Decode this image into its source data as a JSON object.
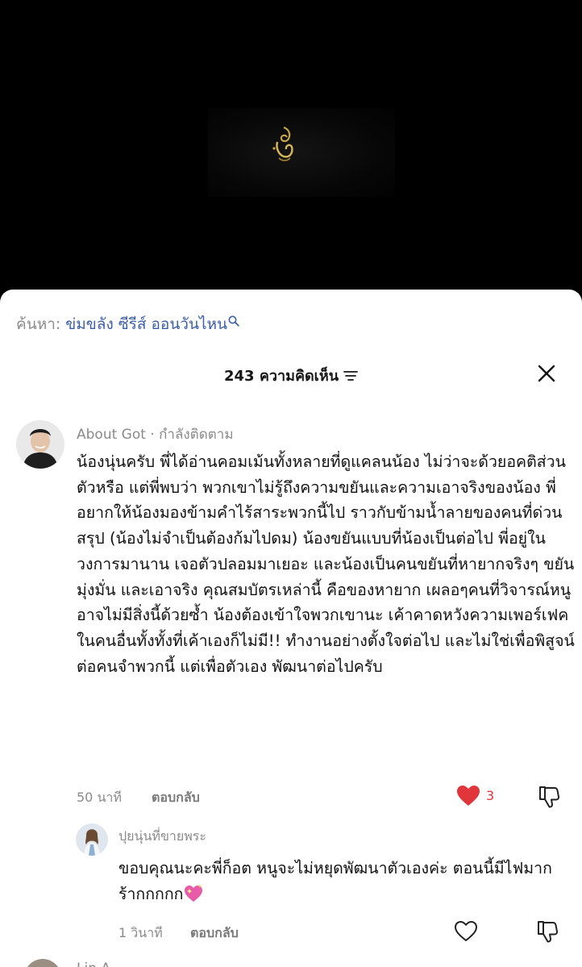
{
  "search": {
    "prefix": "ค้นหา:",
    "query": "ข่มขลัง ซีรีส์ ออนวันไหน"
  },
  "header": {
    "comment_count_label": "243 ความคิดเห็น"
  },
  "comments": [
    {
      "author": "About Got · กำลังติดตาม",
      "text": "น้องนุ่นครับ พี่ได้อ่านคอมเม้นทั้งหลายที่ดูแคลนน้อง ไม่ว่าจะด้วยอคติส่วนตัวหรือ แต่พี่พบว่า พวกเขาไม่รู้ถึงความขยันและความเอาจริงของน้อง พี่อยากให้น้องมองข้ามคำไร้สาระพวกนี้ไป ราวกับข้ามน้ำลายของคนที่ด่วนสรุป (น้องไม่จำเป็นต้องก้มไปดม) น้องขยันแบบที่น้องเป็นต่อไป พี่อยู่ในวงการมานาน เจอตัวปลอมมาเยอะ และน้องเป็นคนขยันที่หายากจริงๆ ขยัน มุ่งมั่น และเอาจริง คุณสมบัตรเหล่านี้ คือของหายาก เผลอๆคนที่วิจารณ์หนูอาจไม่มีสิ่งนี้ด้วยซ้ำ น้องต้องเข้าใจพวกเขานะ เค้าคาดหวังความเพอร์เฟคในคนอื่นทั้งทั้งที่เค้าเองก็ไม่มี!! ทำงานอย่างตั้งใจต่อไป และไม่ใช่เพื่อพิสูจน์ต่อคนจำพวกนี้ แต่เพื่อตัวเอง พัฒนาต่อไปครับ",
      "time": "50 นาที",
      "reply_label": "ตอบกลับ",
      "like_count": "3",
      "liked": true
    }
  ],
  "reply": {
    "author": "ปุยนุ่นที่ขายพระ",
    "text": "ขอบคุณนะคะพี่ก็อต หนูจะไม่หยุดพัฒนาตัวเองค่ะ ตอนนี้มีไฟมาก ร้ากกกกก",
    "time": "1 วินาที",
    "reply_label": "ตอบกลับ"
  },
  "next_comment": {
    "author": "Lin A"
  },
  "colors": {
    "link_blue": "#3b5ea8",
    "like_red": "#e0353a",
    "muted_gray": "#8a8a8a"
  }
}
